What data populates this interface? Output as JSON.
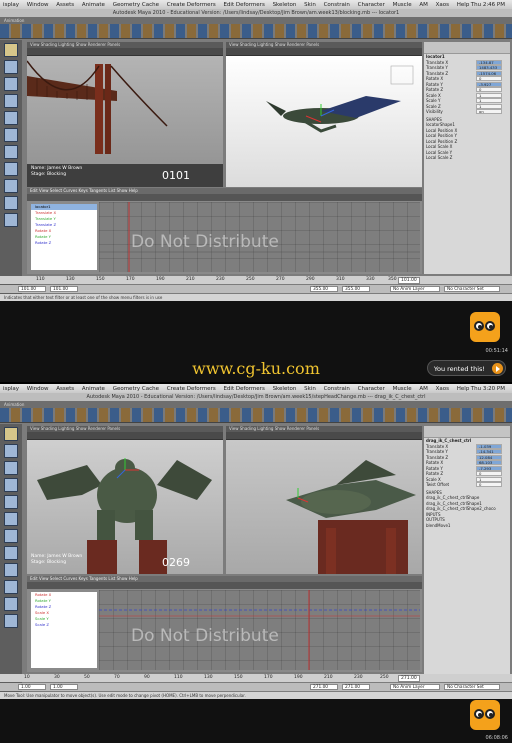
{
  "menu": {
    "items": [
      "isplay",
      "Window",
      "Assets",
      "Animate",
      "Geometry Cache",
      "Create Deformers",
      "Edit Deformers",
      "Skeleton",
      "Skin",
      "Constrain",
      "Character",
      "Muscle",
      "AM",
      "Xaos",
      "Help"
    ]
  },
  "top": {
    "clock": "Thu 2:46 PM",
    "title": "Autodesk Maya 2010 - Educational Version: /Users/lindsay/Desktop/Jim Brown/am.week13/blocking.mb --- locator1",
    "left_frame": "0101",
    "hud_name": "Name: James W Brown",
    "hud_stage": "Stage: Blocking",
    "watermark": "Do Not Distribute",
    "channel_title": "locator1",
    "channels": [
      {
        "label": "Translate X",
        "value": "-134.87"
      },
      {
        "label": "Translate Y",
        "value": "1483.433"
      },
      {
        "label": "Translate Z",
        "value": "-1574.06"
      },
      {
        "label": "Rotate X",
        "value": "0"
      },
      {
        "label": "Rotate Y",
        "value": "-3.927"
      },
      {
        "label": "Rotate Z",
        "value": "0"
      },
      {
        "label": "Scale X",
        "value": "1"
      },
      {
        "label": "Scale Y",
        "value": "1"
      },
      {
        "label": "Scale Z",
        "value": "1"
      },
      {
        "label": "Visibility",
        "value": "on"
      }
    ],
    "shapes_label": "SHAPES",
    "shape_name": "locatorShape1",
    "shape_channels": [
      "Local Position X",
      "Local Position Y",
      "Local Position Z",
      "Local Scale X",
      "Local Scale Y",
      "Local Scale Z"
    ],
    "outliner": [
      "locator1",
      "Translate X",
      "Translate Y",
      "Translate Z",
      "Rotate X",
      "Rotate Y",
      "Rotate Z"
    ],
    "range_start": "101.00",
    "range_inner_start": "101.00",
    "range_end": "355.00",
    "range_inner_end": "355.00",
    "current_frame": "101.00",
    "anim_layer": "No Anim Layer",
    "char_set": "No Character Set",
    "help": "Indicates that either text filter or at least one of the show menu filters is in use",
    "ticks": [
      "110",
      "120",
      "130",
      "140",
      "150",
      "160",
      "170",
      "180",
      "190",
      "200",
      "210",
      "220",
      "230",
      "240",
      "250",
      "260",
      "270",
      "280",
      "290",
      "300",
      "310",
      "320",
      "330",
      "340",
      "350"
    ]
  },
  "video": {
    "timestamp_top": "00:51:14",
    "timestamp_bottom": "06:08:06",
    "site": "www.cg-ku.com",
    "rented": "You rented this!"
  },
  "bottom": {
    "clock": "Thu 3:20 PM",
    "title": "Autodesk Maya 2010 - Educational Version: /Users/lindsay/Desktop/Jim Brown/am.week15/stepHeadChange.mb --- drag_ik_C_chest_ctrl",
    "left_frame": "0269",
    "hud_name": "Name: James W Brown",
    "hud_stage": "Stage: Blocking",
    "watermark": "Do Not Distribute",
    "channel_title": "drag_ik_C_chest_ctrl",
    "channels": [
      {
        "label": "Translate X",
        "value": "-1.039"
      },
      {
        "label": "Translate Y",
        "value": "-14.341"
      },
      {
        "label": "Translate Z",
        "value": "12.084"
      },
      {
        "label": "Rotate X",
        "value": "68.103"
      },
      {
        "label": "Rotate Y",
        "value": "-7.293"
      },
      {
        "label": "Rotate Z",
        "value": "0"
      },
      {
        "label": "Scale X",
        "value": "1"
      },
      {
        "label": "Twist Offset",
        "value": "0"
      }
    ],
    "shapes_label": "SHAPES",
    "shape_lines": [
      "drag_ik_C_chest_ctrlShape",
      "drag_ik_C_chest_ctrlShape1",
      "drag_ik_C_chest_ctrlShape2_choco"
    ],
    "inputs_label": "INPUTS",
    "outputs_label": "OUTPUTS",
    "output_name": "blendMove1",
    "outliner": [
      "Rotate X",
      "Rotate Y",
      "Rotate Z",
      "Scale X",
      "Scale Y",
      "Scale Z"
    ],
    "range_start": "1.00",
    "range_inner_start": "1.00",
    "range_end": "271.00",
    "range_inner_end": "271.00",
    "current_frame": "271.00",
    "anim_layer": "No Anim Layer",
    "char_set": "No Character Set",
    "help": "Move Tool: Use manipulator to move object(s). Use edit mode to change pivot (HOME). Ctrl+LMB to move perpendicular.",
    "ticks": [
      "10",
      "20",
      "30",
      "40",
      "50",
      "60",
      "70",
      "80",
      "90",
      "100",
      "110",
      "120",
      "130",
      "140",
      "150",
      "160",
      "170",
      "180",
      "190",
      "200",
      "210",
      "220",
      "230",
      "240",
      "250",
      "260"
    ]
  },
  "colors": {
    "site_yellow": "#f0c430",
    "owl_orange": "#f4a11b"
  }
}
